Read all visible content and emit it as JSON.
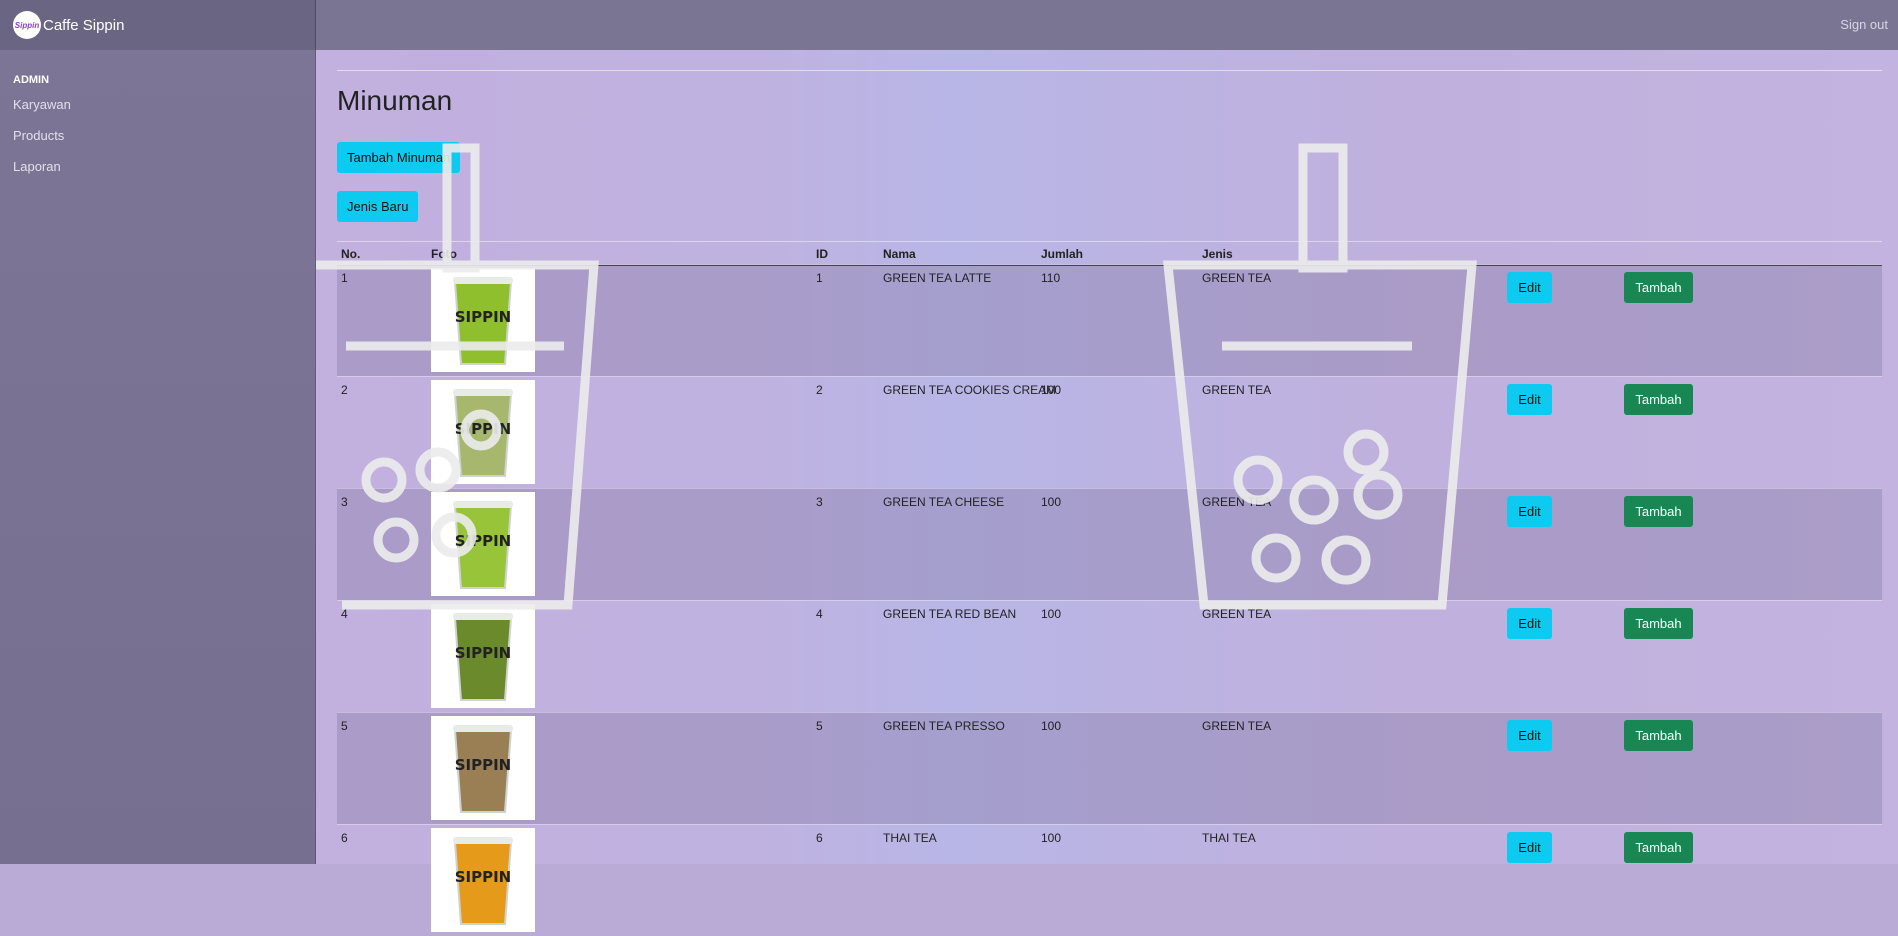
{
  "brand": {
    "name": "Caffe Sippin",
    "logo_text": "Sippin"
  },
  "navbar": {
    "signout": "Sign out"
  },
  "sidebar": {
    "heading": "ADMIN",
    "items": [
      {
        "label": "Karyawan"
      },
      {
        "label": "Products"
      },
      {
        "label": "Laporan"
      }
    ]
  },
  "main": {
    "title": "Minuman",
    "add_button": "Tambah Minuman",
    "new_type_button": "Jenis Baru"
  },
  "table": {
    "headers": [
      "No.",
      "Foto",
      "ID",
      "Nama",
      "Jumlah",
      "Jenis"
    ],
    "edit_label": "Edit",
    "add_label": "Tambah",
    "rows": [
      {
        "no": "1",
        "id": "1",
        "nama": "GREEN TEA LATTE",
        "jumlah": "110",
        "jenis": "GREEN TEA",
        "cup_color": "#8fbf2c"
      },
      {
        "no": "2",
        "id": "2",
        "nama": "GREEN TEA COOKIES CREAM",
        "jumlah": "100",
        "jenis": "GREEN TEA",
        "cup_color": "#a8b76e"
      },
      {
        "no": "3",
        "id": "3",
        "nama": "GREEN TEA CHEESE",
        "jumlah": "100",
        "jenis": "GREEN TEA",
        "cup_color": "#98c43a"
      },
      {
        "no": "4",
        "id": "4",
        "nama": "GREEN TEA RED BEAN",
        "jumlah": "100",
        "jenis": "GREEN TEA",
        "cup_color": "#6a8a2c"
      },
      {
        "no": "5",
        "id": "5",
        "nama": "GREEN TEA PRESSO",
        "jumlah": "100",
        "jenis": "GREEN TEA",
        "cup_color": "#9a7f55"
      },
      {
        "no": "6",
        "id": "6",
        "nama": "THAI TEA",
        "jumlah": "100",
        "jenis": "THAI TEA",
        "cup_color": "#e59a1a"
      }
    ]
  },
  "photo_text": "SIPPIN",
  "colors": {
    "info": "#0dcaf0",
    "success": "#198754",
    "navbar": "#797592",
    "sidebar": "#7d7595"
  }
}
